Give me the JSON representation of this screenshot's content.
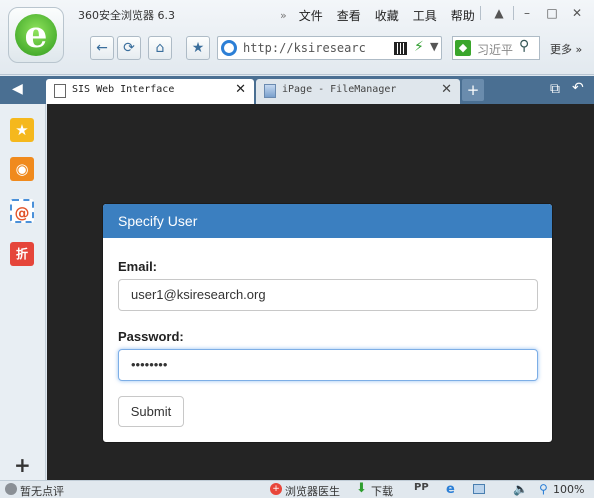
{
  "browser": {
    "app_title": "360安全浏览器 6.3",
    "menus": [
      "文件",
      "查看",
      "收藏",
      "工具",
      "帮助"
    ],
    "menu_overflow": "»",
    "url": "http://ksiresearc",
    "search_placeholder": "习近平",
    "more_label": "更多 »",
    "logo_glyph": "e"
  },
  "tabs": [
    {
      "label": "SIS Web Interface",
      "active": true,
      "close": "✕"
    },
    {
      "label": "iPage - FileManager",
      "active": false,
      "close": "✕"
    }
  ],
  "tab_new": "+",
  "sidebar": {
    "favorites_glyph": "★",
    "weibo_glyph": "◉",
    "mail_glyph": "@",
    "deals_glyph": "折",
    "add_glyph": "+"
  },
  "dialog": {
    "title": "Specify User",
    "email_label": "Email:",
    "email_value": "user1@ksiresearch.org",
    "password_label": "Password:",
    "password_value": "••••••••",
    "submit_label": "Submit"
  },
  "statusbar": {
    "comments": "暂无点评",
    "doctor": "浏览器医生",
    "download": "下载",
    "p2p": "PP",
    "zoom": "100%"
  },
  "colors": {
    "dialog_header": "#3b7fc0",
    "page_background": "#242424",
    "tab_bar": "#4a6f92"
  }
}
